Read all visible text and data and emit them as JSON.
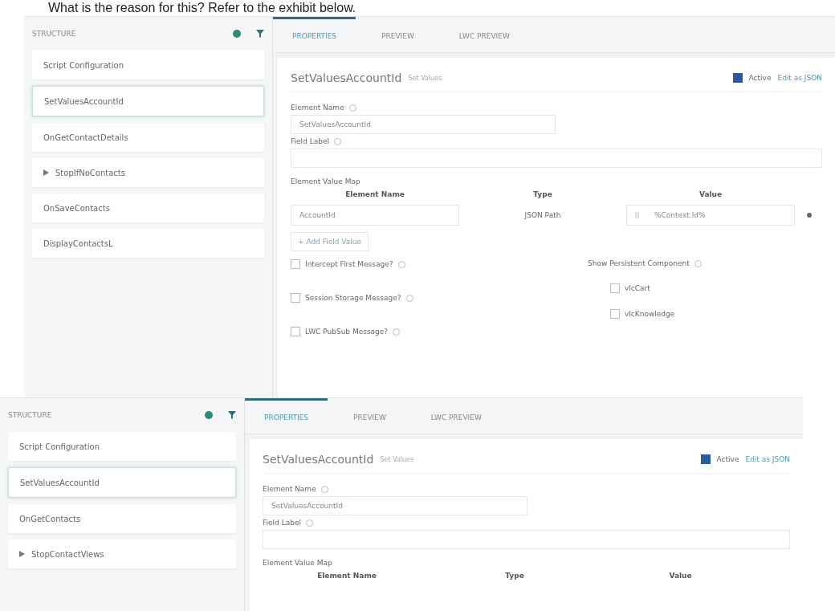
{
  "question_text": "What is the reason for this? Refer to the exhibit below.",
  "exhibits": [
    {
      "structure": {
        "title": "STRUCTURE",
        "items": [
          {
            "label": "Script Configuration",
            "selected": false,
            "expandable": false
          },
          {
            "label": "SetValuesAccountId",
            "selected": true,
            "expandable": false
          },
          {
            "label": "OnGetContactDetails",
            "selected": false,
            "expandable": false
          },
          {
            "label": "StopIfNoContacts",
            "selected": false,
            "expandable": true
          },
          {
            "label": "OnSaveContacts",
            "selected": false,
            "expandable": false
          },
          {
            "label": "DisplayContactsL",
            "selected": false,
            "expandable": false
          }
        ]
      },
      "tabs": [
        {
          "label": "PROPERTIES",
          "selected": true
        },
        {
          "label": "PREVIEW",
          "selected": false
        },
        {
          "label": "LWC PREVIEW",
          "selected": false
        }
      ],
      "element": {
        "name": "SetValuesAccountId",
        "type": "Set Values",
        "active_label": "Active",
        "active": true,
        "edit_link": "Edit as JSON"
      },
      "fields": [
        {
          "label": "Element Name",
          "value": "SetValuesAccountId",
          "wide": false
        },
        {
          "label": "Field Label",
          "wide": true
        }
      ],
      "value_map": {
        "title": "Element Value Map",
        "columns": [
          "Element Name",
          "Type",
          "Value"
        ],
        "rows": [
          {
            "element_name": "AccountId",
            "type": "JSON Path",
            "value": "%Context.Id%"
          }
        ]
      },
      "add_button": "+ Add Field Value",
      "options": [
        {
          "label": "Intercept First Message?",
          "checked": false
        },
        {
          "label": "Session Storage Message?",
          "checked": false
        },
        {
          "label": "LWC PubSub Message?",
          "checked": false
        }
      ],
      "persistent": {
        "label": "Show Persistent Component",
        "options": [
          {
            "label": "vlcCart",
            "checked": false
          },
          {
            "label": "vlcKnowledge",
            "checked": false
          }
        ]
      }
    },
    {
      "structure": {
        "title": "STRUCTURE",
        "items": [
          {
            "label": "Script Configuration",
            "selected": false,
            "expandable": false
          },
          {
            "label": "SetValuesAccountId",
            "selected": true,
            "expandable": false
          },
          {
            "label": "OnGetContacts",
            "selected": false,
            "expandable": false
          },
          {
            "label": "StopContactViews",
            "selected": false,
            "expandable": true
          }
        ]
      },
      "tabs": [
        {
          "label": "PROPERTIES",
          "selected": true
        },
        {
          "label": "PREVIEW",
          "selected": false
        },
        {
          "label": "LWC PREVIEW",
          "selected": false
        }
      ],
      "element": {
        "name": "SetValuesAccountId",
        "type": "Set Values",
        "active_label": "Active",
        "active": true,
        "edit_link": "Edit as JSON"
      },
      "fields": [
        {
          "label": "Element Name",
          "value": "SetValuesAccountId",
          "wide": false
        },
        {
          "label": "Field Label",
          "wide": true
        }
      ],
      "value_map": {
        "title": "Element Value Map",
        "columns": [
          "Element Name",
          "Type",
          "Value"
        ]
      }
    }
  ]
}
